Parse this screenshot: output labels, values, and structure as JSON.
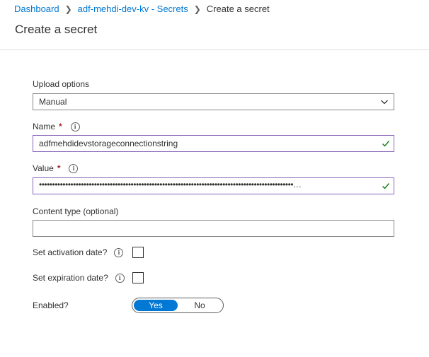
{
  "breadcrumb": {
    "items": [
      "Dashboard",
      "adf-mehdi-dev-kv - Secrets"
    ],
    "current": "Create a secret"
  },
  "page": {
    "title": "Create a secret"
  },
  "form": {
    "upload_options": {
      "label": "Upload options",
      "value": "Manual"
    },
    "name": {
      "label": "Name",
      "required_mark": "*",
      "value": "adfmehdidevstorageconnectionstring"
    },
    "value": {
      "label": "Value",
      "required_mark": "*",
      "value": "•••••••••••••••••••••••••••••••••••••••••••••••••••••••••••••••••••••••••••••••••••••••••••••••••…"
    },
    "content_type": {
      "label": "Content type (optional)",
      "value": ""
    },
    "activation": {
      "label": "Set activation date?"
    },
    "expiration": {
      "label": "Set expiration date?"
    },
    "enabled": {
      "label": "Enabled?",
      "yes": "Yes",
      "no": "No"
    }
  },
  "icons": {
    "info": "i"
  },
  "colors": {
    "accent": "#0078d4",
    "valid_border": "#8764b8",
    "check": "#107c10",
    "required": "#a4262c"
  }
}
